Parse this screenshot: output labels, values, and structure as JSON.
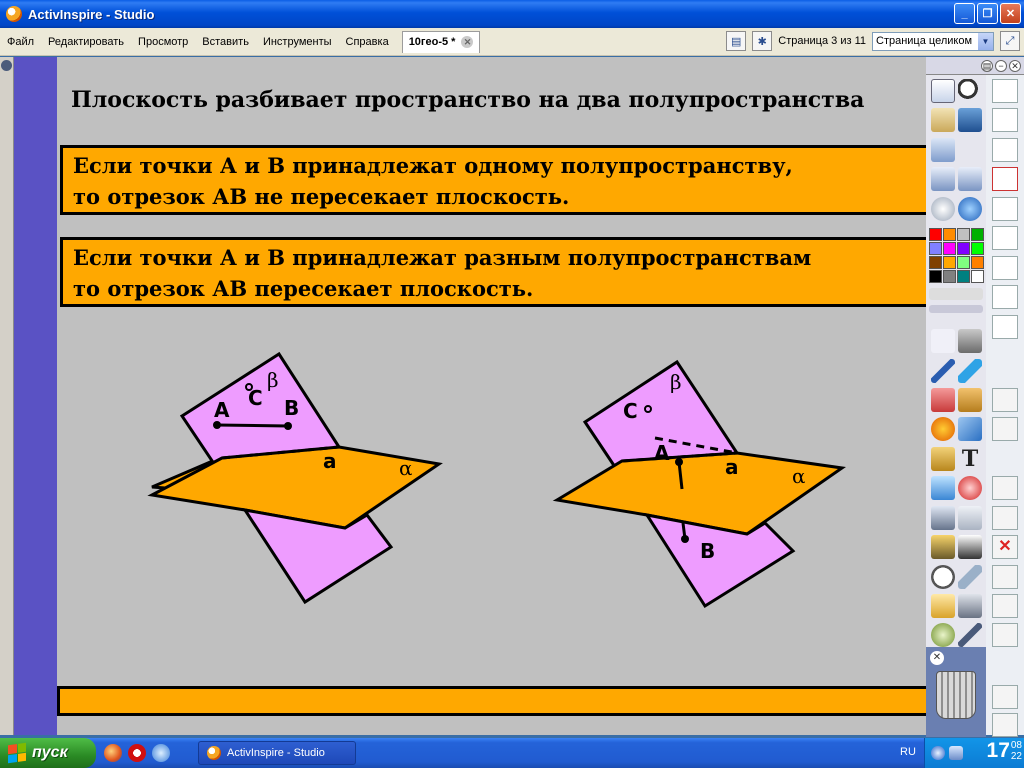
{
  "window": {
    "title": "ActivInspire - Studio"
  },
  "menu": {
    "items": [
      "Файл",
      "Редактировать",
      "Просмотр",
      "Вставить",
      "Инструменты",
      "Справка"
    ],
    "doc_tab": "10гео-5 *",
    "page_indicator": "Страница 3 из 11",
    "zoom_value": "Страница целиком"
  },
  "slide": {
    "heading": "Плоскость разбивает пространство на два полупространства",
    "rule1_line1": "Если точки А и В принадлежат одному полупространству,",
    "rule1_line2": "то отрезок АВ не пересекает плоскость.",
    "rule2_line1": "Если точки А и В  принадлежат разным полупространствам",
    "rule2_line2": "то отрезок АВ пересекает плоскость.",
    "fig1": {
      "label_A": "А",
      "label_B": "В",
      "label_C": "С",
      "label_a": "а",
      "label_alpha": "α",
      "label_beta": "β"
    },
    "fig2": {
      "label_A": "А",
      "label_B": "В",
      "label_C": "С",
      "label_a": "а",
      "label_alpha": "α",
      "label_beta": "β"
    }
  },
  "colors": {
    "plane_alpha": "#ffa800",
    "plane_beta": "#ee9cff",
    "canvas": "#c0c0c0",
    "rule_box": "#ffa800",
    "toolbox_bg": "#5a52c4"
  },
  "toolbox": {
    "icons": [
      "browsers-icon",
      "zoom-icon",
      "profile-icon",
      "signature-icon",
      "tools-icon",
      "prev-page-icon",
      "next-page-icon",
      "play-icon",
      "web-browser-icon",
      "select-icon",
      "tools-settings-icon",
      "pen-icon",
      "highlighter-icon",
      "eraser-icon",
      "fill-icon",
      "shape-icon",
      "connector-icon",
      "text-tool-icon",
      "text-icon",
      "magic-ink-icon",
      "reset-icon",
      "undo-icon",
      "redo-icon",
      "recorder-icon",
      "camera-icon",
      "clock-icon",
      "ruler-icon",
      "protractor-icon",
      "screen-capture-icon",
      "pen-tool-icon",
      "compass-icon"
    ],
    "palette": [
      "#ff0000",
      "#ff8c00",
      "#c0c0c0",
      "#00b000",
      "#8080ff",
      "#ff00ff",
      "#8000ff",
      "#00ff00",
      "#804000",
      "#ffa800",
      "#80ff80",
      "#ff8000",
      "#000000",
      "#808080",
      "#008080",
      "#ffffff"
    ],
    "bin_label": "recycle-bin-icon"
  },
  "taskbar": {
    "start_label": "пуск",
    "task_label": "ActivInspire - Studio",
    "lang": "RU",
    "clock_hour": "17",
    "clock_min": "08",
    "clock_sec": "22"
  }
}
